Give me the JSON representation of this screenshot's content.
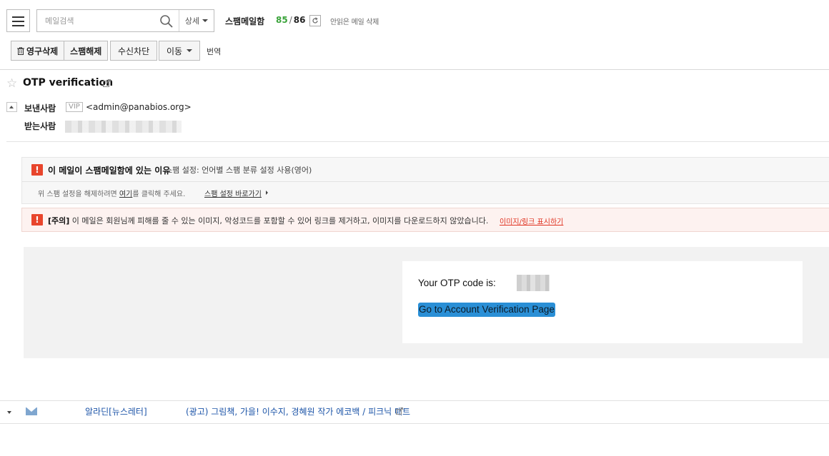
{
  "toolbar": {
    "search_placeholder": "메일검색",
    "detail_label": "상세",
    "folder_name": "스팸메일함",
    "unread_count": "85",
    "separator": "/",
    "total_count": "86",
    "auto_delete_text": "안읽은 메일 삭제",
    "delete_forever": "영구삭제",
    "not_spam": "스팸해제",
    "block": "수신차단",
    "move": "이동",
    "translate": "번역"
  },
  "message": {
    "subject": "OTP verification",
    "from_label": "보낸사람",
    "vip_badge": "VIP",
    "from_address": "<admin@panabios.org>",
    "to_label": "받는사람"
  },
  "spam_notice": {
    "title": "이 메일이 스팸메일함에 있는 이유",
    "reason": "스팸 설정: 언어별 스팸 분류 설정 사용(영어)",
    "hint_before": "위 스팸 설정을 해제하려면 ",
    "hint_link": "여기",
    "hint_after": "를 클릭해 주세요.",
    "settings_link": "스팸 설정 바로가기"
  },
  "caution_notice": {
    "tag": "[주의]",
    "text": " 이 메일은 회원님께 피해를 줄 수 있는 이미지, 악성코드를 포함할 수 있어 링크를 제거하고, 이미지를 다운로드하지 않았습니다.",
    "show_link": "이미지/링크 표시하기"
  },
  "body": {
    "otp_label": "Your OTP code is:",
    "button_label": "Go to Account Verification Page"
  },
  "next_mail": {
    "sender": "알라딘[뉴스레터]",
    "subject": "(광고) 그림책, 가을! 이수지, 경혜원 작가 에코백 / 피크닉 매트"
  },
  "colors": {
    "unread": "#3aa33a",
    "warning": "#e8452c",
    "caution_bg": "#fdf2f0",
    "button": "#2a8fd6",
    "link_blue": "#1d55a8"
  }
}
